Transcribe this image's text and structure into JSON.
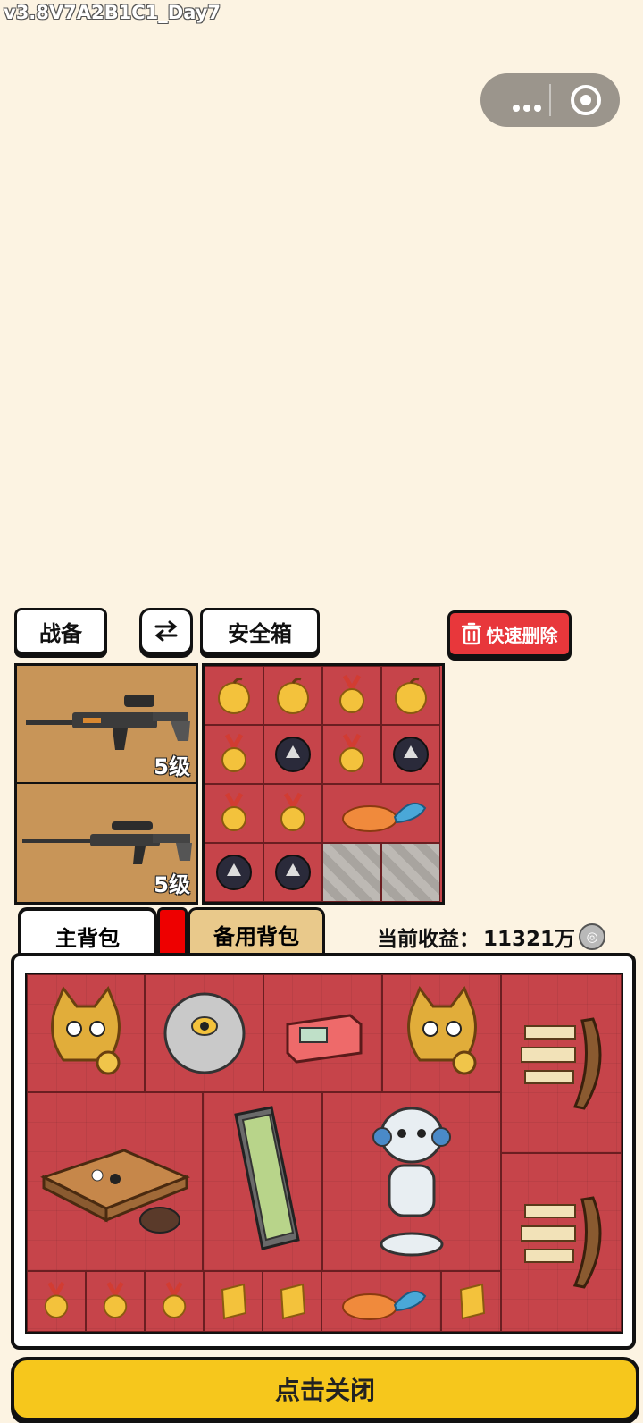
{
  "version": "v3.8V7A2B1C1_Day7",
  "top_tabs": {
    "gear": "战备",
    "swap_icon": "swap-arrows-icon",
    "safebox": "安全箱"
  },
  "quick_delete": "快速删除",
  "gear": [
    {
      "item": "assault-rifle",
      "level": "5级"
    },
    {
      "item": "sniper-rifle",
      "level": "5级"
    }
  ],
  "safebox_items": [
    "golden-apple",
    "golden-apple",
    "medal",
    "golden-apple",
    "medal",
    "wolf-orb",
    "medal",
    "wolf-orb",
    "medal",
    "medal",
    "koi-fish",
    "koi-fish",
    "wolf-orb",
    "wolf-orb",
    "locked",
    "locked"
  ],
  "bag_tabs": {
    "main": "主背包",
    "spare": "备用背包"
  },
  "earnings": {
    "label": "当前收益：",
    "value": "11321万"
  },
  "close_label": "点击关闭",
  "colors": {
    "grid_red": "#c6444a",
    "background": "#fcf3e2",
    "close_yellow": "#f6c71c",
    "delete_red": "#e8373b"
  }
}
